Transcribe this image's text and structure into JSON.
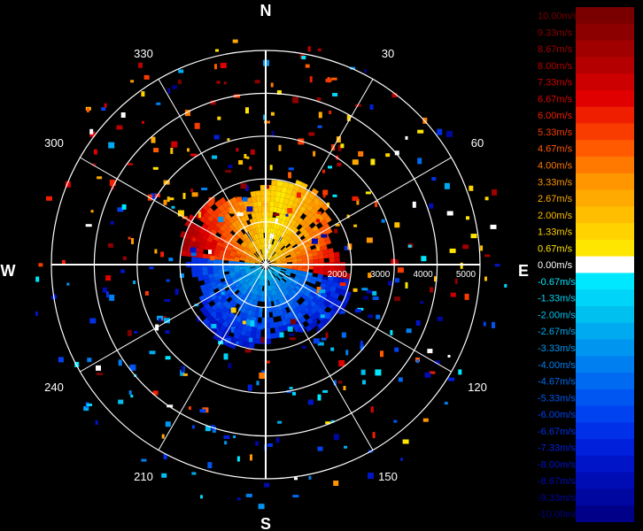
{
  "chart_data": {
    "type": "polar-radar",
    "cardinals": [
      "N",
      "E",
      "S",
      "W"
    ],
    "azimuth_labels": [
      {
        "angle": 30,
        "label": "30"
      },
      {
        "angle": 60,
        "label": "60"
      },
      {
        "angle": 120,
        "label": "120"
      },
      {
        "angle": 150,
        "label": "150"
      },
      {
        "angle": 210,
        "label": "210"
      },
      {
        "angle": 240,
        "label": "240"
      },
      {
        "angle": 300,
        "label": "300"
      },
      {
        "angle": 330,
        "label": "330"
      }
    ],
    "range_rings": [
      1000,
      2000,
      3000,
      4000,
      5000
    ],
    "range_labels": [
      {
        "value": 2000,
        "label": "2000"
      },
      {
        "value": 3000,
        "label": "3000"
      },
      {
        "value": 4000,
        "label": "4000"
      },
      {
        "value": 5000,
        "label": "5000"
      }
    ],
    "max_range": 5000,
    "spoke_angles": [
      0,
      30,
      60,
      90,
      120,
      150,
      180,
      210,
      240,
      270,
      300,
      330
    ],
    "grid": true,
    "legend_position": "right",
    "colorscale": [
      {
        "label": "10.00m/s",
        "color": "#7a0000"
      },
      {
        "label": "9.33m/s",
        "color": "#8c0000"
      },
      {
        "label": "8.67m/s",
        "color": "#a00000"
      },
      {
        "label": "8.00m/s",
        "color": "#b40000"
      },
      {
        "label": "7.33m/s",
        "color": "#cc0000"
      },
      {
        "label": "6.67m/s",
        "color": "#e00000"
      },
      {
        "label": "6.00m/s",
        "color": "#f01e00"
      },
      {
        "label": "5.33m/s",
        "color": "#f83c00"
      },
      {
        "label": "4.67m/s",
        "color": "#ff5a00"
      },
      {
        "label": "4.00m/s",
        "color": "#ff7800"
      },
      {
        "label": "3.33m/s",
        "color": "#ff9600"
      },
      {
        "label": "2.67m/s",
        "color": "#ffaa00"
      },
      {
        "label": "2.00m/s",
        "color": "#ffbe00"
      },
      {
        "label": "1.33m/s",
        "color": "#ffd200"
      },
      {
        "label": "0.67m/s",
        "color": "#ffe600"
      },
      {
        "label": "0.00m/s",
        "color": "#ffffff"
      },
      {
        "label": "-0.67m/s",
        "color": "#00e8ff"
      },
      {
        "label": "-1.33m/s",
        "color": "#00d4f8"
      },
      {
        "label": "-2.00m/s",
        "color": "#00c0f0"
      },
      {
        "label": "-2.67m/s",
        "color": "#00aaf0"
      },
      {
        "label": "-3.33m/s",
        "color": "#0096f0"
      },
      {
        "label": "-4.00m/s",
        "color": "#0080f0"
      },
      {
        "label": "-4.67m/s",
        "color": "#006af0"
      },
      {
        "label": "-5.33m/s",
        "color": "#0056f0"
      },
      {
        "label": "-6.00m/s",
        "color": "#0042f0"
      },
      {
        "label": "-6.67m/s",
        "color": "#0030e8"
      },
      {
        "label": "-7.33m/s",
        "color": "#0020dc"
      },
      {
        "label": "-8.00m/s",
        "color": "#0014c8"
      },
      {
        "label": "-8.67m/s",
        "color": "#000cb4"
      },
      {
        "label": "-9.33m/s",
        "color": "#0006a0"
      },
      {
        "label": "-10.00m/s",
        "color": "#000088"
      }
    ],
    "echo_field": {
      "max_range": 2000,
      "positive_side_azimuth": [
        275,
        100
      ],
      "negative_side_azimuth": [
        100,
        275
      ],
      "peak_velocity": 9.0,
      "outlier_count": 420
    }
  }
}
